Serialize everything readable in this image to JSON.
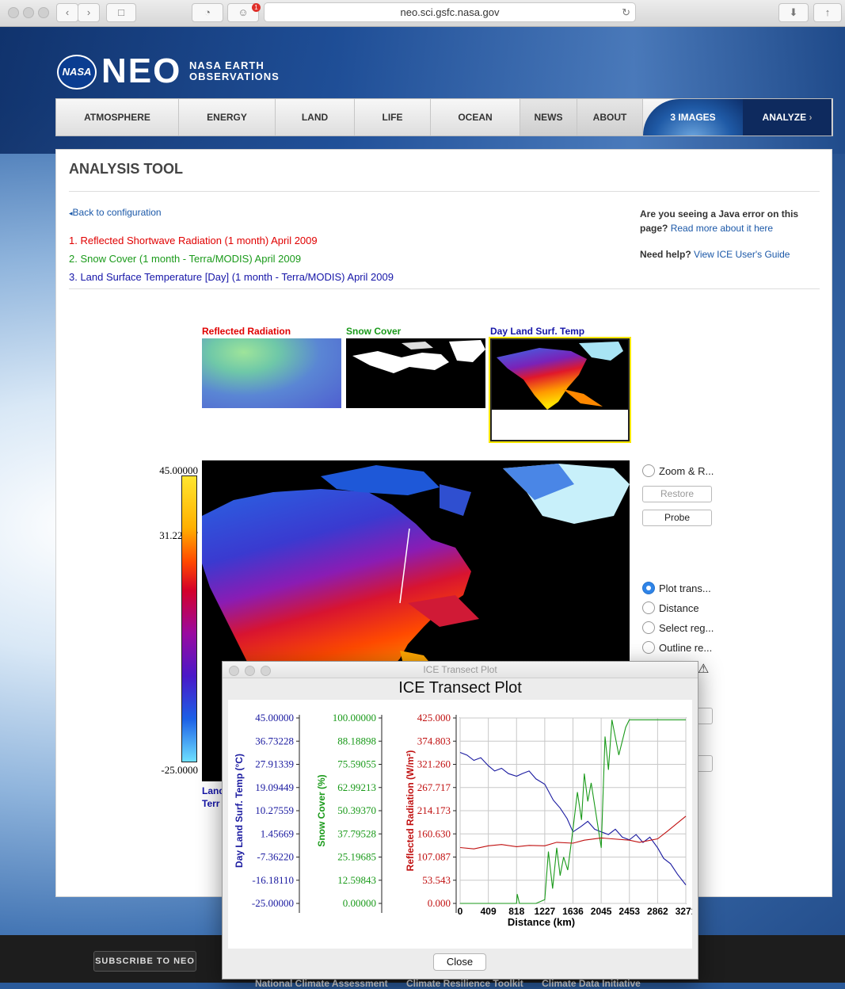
{
  "browser": {
    "url": "neo.sci.gsfc.nasa.gov",
    "notification_count": "1"
  },
  "brand": {
    "nasa": "NASA",
    "neo": "NEO",
    "line1": "NASA EARTH",
    "line2": "OBSERVATIONS"
  },
  "nav": {
    "items": [
      "ATMOSPHERE",
      "ENERGY",
      "LAND",
      "LIFE",
      "OCEAN",
      "NEWS",
      "ABOUT"
    ],
    "images": "3 IMAGES",
    "analyze": "ANALYZE"
  },
  "page": {
    "title": "ANALYSIS TOOL",
    "back_link": "Back to configuration",
    "datasets": [
      {
        "label": "1. Reflected Shortwave Radiation (1 month) April 2009",
        "color": "#e00000"
      },
      {
        "label": "2. Snow Cover (1 month - Terra/MODIS) April 2009",
        "color": "#1a9a1a"
      },
      {
        "label": "3. Land Surface Temperature [Day] (1 month - Terra/MODIS) April 2009",
        "color": "#1515a8"
      }
    ],
    "java_q1": "Are you seeing a Java error on this",
    "java_q2": "page?",
    "java_link": "Read more about it here",
    "help_q": "Need help?",
    "help_link": "View ICE User's Guide"
  },
  "thumbs": [
    {
      "label": "Reflected Radiation",
      "color": "#e00000"
    },
    {
      "label": "Snow Cover",
      "color": "#1a9a1a"
    },
    {
      "label": "Day Land Surf. Temp",
      "color": "#1515a8"
    }
  ],
  "colorscale": {
    "max": "45.00000",
    "mid": "31.22047",
    "min": "-25.0000",
    "caption1": "Land",
    "caption2": "Terr"
  },
  "tools": {
    "zoom": "Zoom & R...",
    "restore": "Restore",
    "probe": "Probe",
    "plot": "Plot trans...",
    "distance": "Distance",
    "select": "Select reg...",
    "outline": "Outline re..."
  },
  "footer": {
    "subscribe": "SUBSCRIBE TO NEO",
    "links": [
      "National Climate Assessment",
      "Climate Resilience Toolkit",
      "Climate Data Initiative"
    ]
  },
  "dialog": {
    "window_title": "ICE Transect Plot",
    "title": "ICE Transect Plot",
    "close": "Close",
    "axis1_label": "Day Land Surf. Temp  (°C)",
    "axis1_ticks": [
      "45.00000",
      "36.73228",
      "27.91339",
      "19.09449",
      "10.27559",
      "1.45669",
      "-7.36220",
      "-16.18110",
      "-25.00000"
    ],
    "axis2_label": "Snow Cover  (%)",
    "axis2_ticks": [
      "100.00000",
      "88.18898",
      "75.59055",
      "62.99213",
      "50.39370",
      "37.79528",
      "25.19685",
      "12.59843",
      "0.00000"
    ],
    "axis3_label": "Reflected Radiation  (W/m²)",
    "axis3_ticks": [
      "425.000",
      "374.803",
      "321.260",
      "267.717",
      "214.173",
      "160.630",
      "107.087",
      "53.543",
      "0.000"
    ],
    "xlabel": "Distance (km)",
    "xticks": [
      "0",
      "409",
      "818",
      "1227",
      "1636",
      "2045",
      "2453",
      "2862",
      "3271"
    ]
  },
  "chart_data": {
    "type": "line",
    "title": "ICE Transect Plot",
    "xlabel": "Distance (km)",
    "xlim": [
      0,
      3271
    ],
    "grid": true,
    "series": [
      {
        "name": "Day Land Surf. Temp",
        "unit": "°C",
        "color": "#1a1aa0",
        "ylim": [
          -25,
          45
        ],
        "x": [
          0,
          100,
          200,
          300,
          409,
          500,
          600,
          700,
          818,
          900,
          1000,
          1100,
          1227,
          1350,
          1450,
          1550,
          1636,
          1750,
          1850,
          1950,
          2045,
          2150,
          2250,
          2350,
          2453,
          2550,
          2650,
          2750,
          2862,
          2950,
          3050,
          3150,
          3271
        ],
        "y": [
          32,
          31,
          29,
          30,
          27,
          25,
          26,
          24,
          23,
          24,
          25,
          22,
          20,
          14,
          11,
          7,
          2,
          4,
          6,
          3,
          2,
          1,
          3,
          0,
          -1,
          1,
          -2,
          0,
          -4,
          -8,
          -10,
          -14,
          -18
        ]
      },
      {
        "name": "Snow Cover",
        "unit": "%",
        "color": "#1a9a1a",
        "ylim": [
          0,
          100
        ],
        "x": [
          0,
          409,
          818,
          828,
          860,
          900,
          1000,
          1100,
          1227,
          1280,
          1340,
          1400,
          1450,
          1500,
          1560,
          1636,
          1700,
          1760,
          1800,
          1850,
          1900,
          2045,
          2100,
          2150,
          2200,
          2300,
          2400,
          2453,
          2500,
          2600,
          2700,
          2800,
          2862,
          2950,
          3050,
          3271
        ],
        "y": [
          0,
          0,
          0,
          5,
          0,
          0,
          0,
          0,
          2,
          28,
          8,
          30,
          15,
          25,
          18,
          40,
          60,
          45,
          70,
          55,
          65,
          30,
          90,
          72,
          99,
          80,
          95,
          99,
          99,
          99,
          99,
          99,
          99,
          99,
          99,
          99
        ]
      },
      {
        "name": "Reflected Radiation",
        "unit": "W/m²",
        "color": "#c01010",
        "ylim": [
          0,
          425
        ],
        "x": [
          0,
          200,
          409,
          600,
          818,
          1000,
          1227,
          1400,
          1636,
          1800,
          2045,
          2200,
          2453,
          2600,
          2862,
          3000,
          3271
        ],
        "y": [
          128,
          125,
          132,
          135,
          130,
          133,
          132,
          140,
          138,
          145,
          150,
          148,
          145,
          140,
          148,
          165,
          200
        ]
      }
    ]
  }
}
